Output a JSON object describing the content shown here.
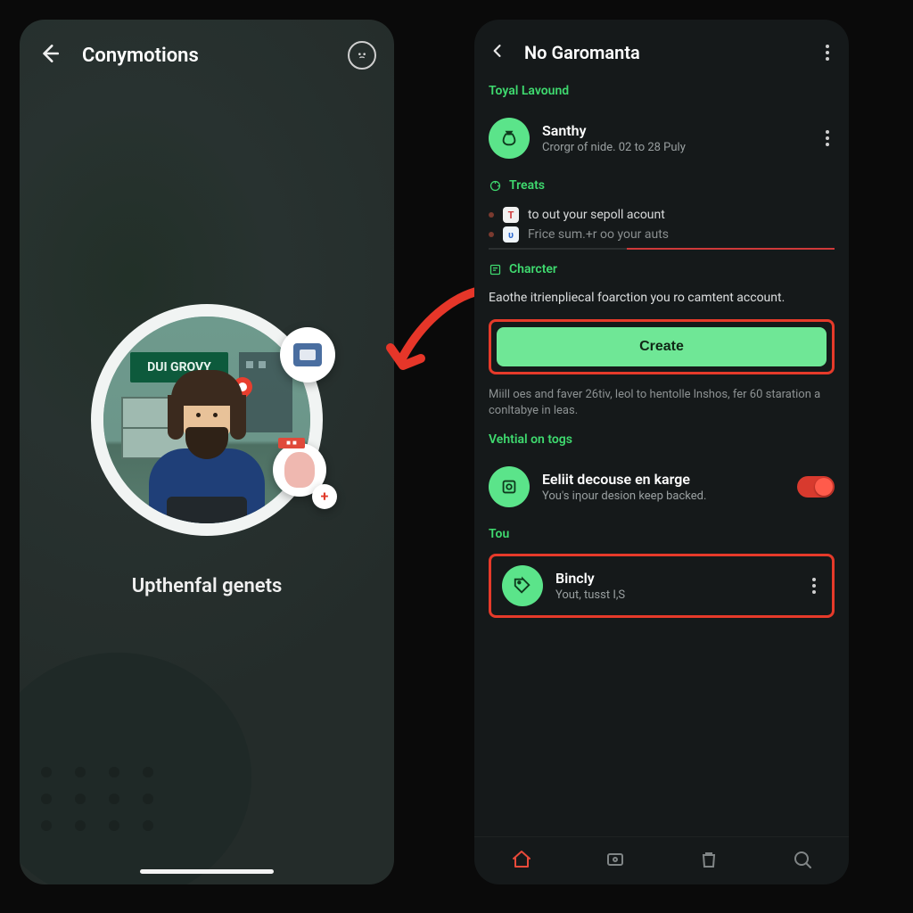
{
  "colors": {
    "accent": "#5be48a",
    "highlight": "#e63a2a"
  },
  "left": {
    "title": "Conymotions",
    "illustration_sign": "DUI GROVY",
    "caption": "Upthenfal genets"
  },
  "right": {
    "title": "No Garomanta",
    "sections": {
      "toyal": {
        "label": "Toyal Lavound",
        "item": {
          "title": "Santhy",
          "sub": "Crorgr of nide. 02 to 28 Puly"
        }
      },
      "treats": {
        "label": "Treats",
        "row1": "to out your sepoll acount",
        "row2": "Frice sum.+r oo your auts"
      },
      "charcter": {
        "label": "Charcter",
        "desc": "Eaothe itrienpliecal foarction you ro camtent account.",
        "button": "Create",
        "hint": "Miill oes and faver 26tiv, leol to hentolle lnshos, fer 60 staration a conltabye in leas."
      },
      "vehtial": {
        "label": "Vehtial on togs",
        "item": {
          "title": "Eeliit decouse en karge",
          "sub": "You's iηour desion keep backed."
        }
      },
      "tou": {
        "label": "Tou",
        "item": {
          "title": "Bincly",
          "sub": "Yout, tusst I,S"
        }
      }
    }
  }
}
